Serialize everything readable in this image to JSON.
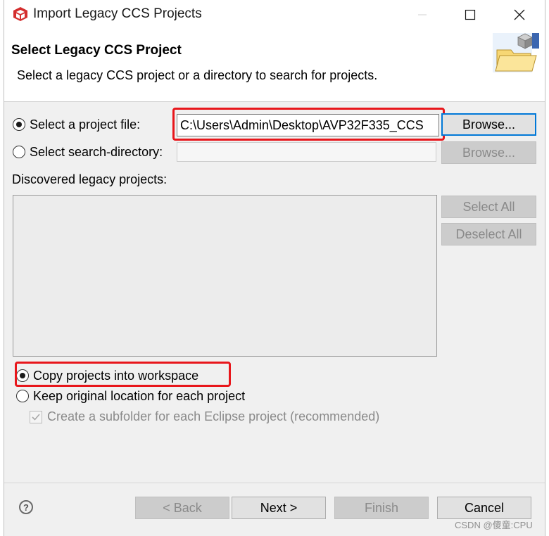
{
  "window": {
    "title": "Import Legacy CCS Projects",
    "controls": {
      "minimize": "minimize-icon",
      "maximize": "maximize-icon",
      "close": "close-icon"
    }
  },
  "banner": {
    "title": "Select Legacy CCS Project",
    "description": "Select a legacy CCS project or a directory to search for projects."
  },
  "source": {
    "project_file_label": "Select a project file:",
    "project_file_value": "C:\\Users\\Admin\\Desktop\\AVP32F335_CCS",
    "project_file_selected": true,
    "browse_label": "Browse...",
    "search_dir_label": "Select search-directory:",
    "search_dir_value": "",
    "search_dir_browse_label": "Browse..."
  },
  "discovered": {
    "label": "Discovered legacy projects:",
    "items": [],
    "select_all_label": "Select All",
    "deselect_all_label": "Deselect All"
  },
  "options": {
    "copy_label": "Copy projects into workspace",
    "copy_selected": true,
    "keep_label": "Keep original location for each project",
    "subfolder_label": "Create a subfolder for each Eclipse project (recommended)",
    "subfolder_checked": true
  },
  "footer": {
    "back_label": "< Back",
    "next_label": "Next >",
    "finish_label": "Finish",
    "cancel_label": "Cancel"
  },
  "watermark": "CSDN @傻童:CPU",
  "colors": {
    "highlight": "#e8161b",
    "focus": "#0078d7",
    "app_icon": "#d42e2e"
  }
}
